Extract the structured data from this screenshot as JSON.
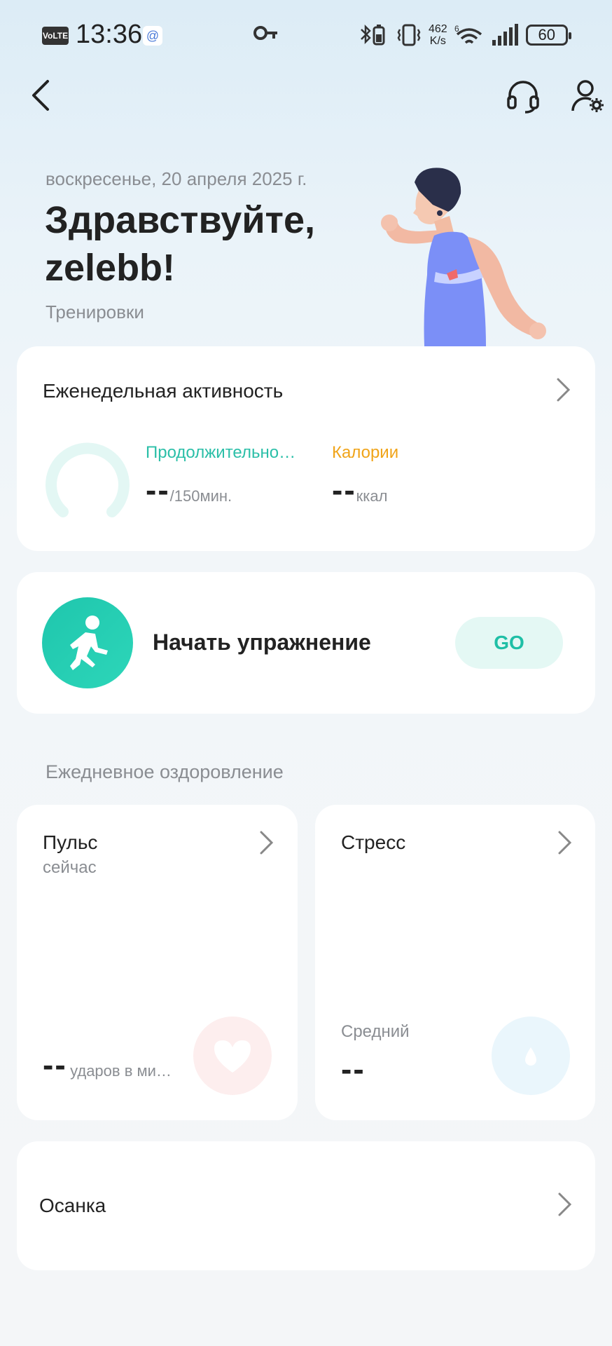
{
  "status_bar": {
    "volte": "VoLTE",
    "time": "13:36",
    "at_icon": "@",
    "speed_value": "462",
    "speed_unit": "K/s",
    "network": "6",
    "battery": "60"
  },
  "nav": {
    "icons": [
      "back-icon",
      "headset-icon",
      "profile-settings-icon"
    ]
  },
  "hero": {
    "date": "воскресенье, 20 апреля 2025 г.",
    "greeting_line1": "Здравствуйте,",
    "greeting_line2": "zelebb!",
    "subtitle": "Тренировки"
  },
  "weekly": {
    "title": "Еженедельная активность",
    "duration_label": "Продолжительно…",
    "duration_value": "--",
    "duration_unit": "/150мин.",
    "calories_label": "Калории",
    "calories_value": "--",
    "calories_unit": "ккал",
    "duration_color": "#2bbfa8",
    "calories_color": "#f0a419"
  },
  "start_exercise": {
    "label": "Начать упражнение",
    "button": "GO",
    "accent": "#1fc6ad"
  },
  "daily": {
    "section_title": "Ежедневное оздоровление",
    "pulse": {
      "title": "Пульс",
      "subtitle": "сейчас",
      "value": "--",
      "unit": "ударов в ми…"
    },
    "stress": {
      "title": "Стресс",
      "subtitle": "Средний",
      "value": "--"
    }
  },
  "posture": {
    "title": "Осанка"
  }
}
